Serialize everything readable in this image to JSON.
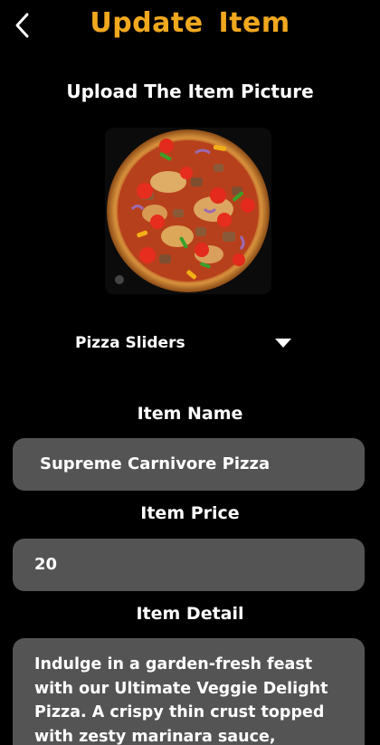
{
  "header": {
    "title": "Update  Item",
    "back_icon": "chevron-left-icon",
    "title_color": "#F0A81E"
  },
  "upload": {
    "label": "Upload The Item Picture",
    "image_description_icon": "pizza-image"
  },
  "category": {
    "selected": "Pizza Sliders",
    "dropdown_icon": "caret-down-icon"
  },
  "form": {
    "name_label": "Item Name",
    "name_value": "Supreme Carnivore Pizza",
    "price_label": "Item Price",
    "price_value": "20",
    "detail_label": "Item Detail",
    "detail_value": "Indulge in a garden-fresh feast with our Ultimate Veggie Delight Pizza. A crispy thin crust topped with zesty marinara sauce,",
    "field_bg_color": "#545454"
  },
  "theme": {
    "background": "#000000",
    "accent": "#F0A81E",
    "text": "#FFFFFF"
  }
}
